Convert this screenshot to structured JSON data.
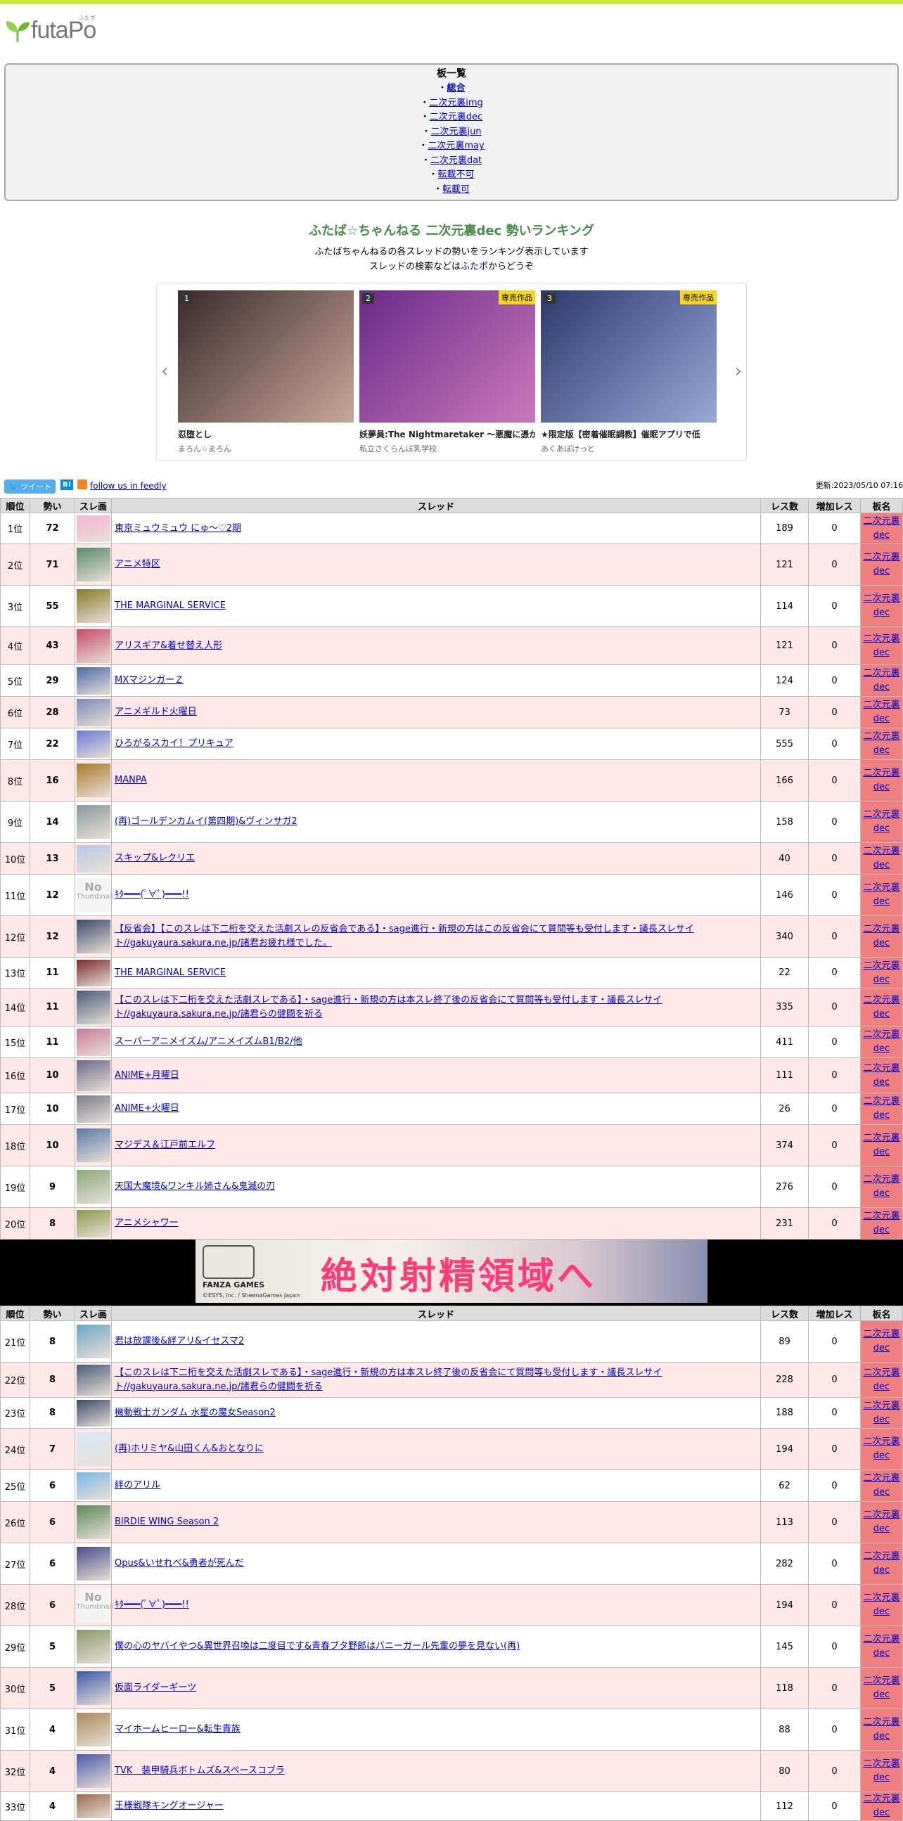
{
  "header": {
    "logo_text": "futaPo",
    "logo_ruby": "ふたポ"
  },
  "board_list": {
    "title": "板一覧",
    "items": [
      {
        "prefix": "・",
        "label": "総合",
        "strong": true
      },
      {
        "prefix": "・",
        "label": "二次元裏img",
        "strong": false
      },
      {
        "prefix": "・",
        "label": "二次元裏dec",
        "strong": false
      },
      {
        "prefix": "・",
        "label": "二次元裏jun",
        "strong": false
      },
      {
        "prefix": "・",
        "label": "二次元裏may",
        "strong": false
      },
      {
        "prefix": "・",
        "label": "二次元裏dat",
        "strong": false
      },
      {
        "prefix": "・",
        "label": "転載不可",
        "strong": false
      },
      {
        "prefix": "・",
        "label": "転載可",
        "strong": false
      }
    ]
  },
  "ranking": {
    "title": "ふたば☆ちゃんねる 二次元裏dec 勢いランキング",
    "desc1": "ふたばちゃんねるの各スレッドの勢いをランキング表示しています",
    "desc2_pre": "スレッドの検索などは",
    "desc2_link": "ふたポ",
    "desc2_post": "からどうぞ"
  },
  "carousel": {
    "prev": "‹",
    "next": "›",
    "cards": [
      {
        "num": "1",
        "excl": "",
        "title": "忍堕とし",
        "circle": "まろん☆まろん",
        "color1": "#3a2a2a",
        "color2": "#c9a89a"
      },
      {
        "num": "2",
        "excl": "専売作品",
        "title": "妖夢員:The Nightmaretaker ～悪魔に憑か",
        "circle": "私立さくらんぼ乳学校",
        "color1": "#6a2a8a",
        "color2": "#c97ab8"
      },
      {
        "num": "3",
        "excl": "専売作品",
        "title": "★限定版【密着催眠調教】催眠アプリで低",
        "circle": "あくあぽけっと",
        "color1": "#2a3a6a",
        "color2": "#9aa8d8"
      }
    ]
  },
  "social": {
    "tweet": "ツイート",
    "hatena": "B!",
    "feedly": "follow us in feedly",
    "updated": "更新:2023/05/10 07:16"
  },
  "table": {
    "headers": [
      "順位",
      "勢い",
      "スレ画",
      "スレッド",
      "レス数",
      "増加レス",
      "板名"
    ],
    "board_line1": "二次元裏",
    "board_line2": "dec",
    "rows1": [
      {
        "rank": "1位",
        "mom": "72",
        "title": "東京ミュウミュウ にゅ～♡2期",
        "res": "189",
        "inc": "0",
        "h": 44,
        "c": "#f7b4d4"
      },
      {
        "rank": "2位",
        "mom": "71",
        "title": "アニメ特区",
        "res": "121",
        "inc": "0",
        "h": 59,
        "c": "#5a8a6a"
      },
      {
        "rank": "3位",
        "mom": "55",
        "title": "THE MARGINAL SERVICE",
        "res": "114",
        "inc": "0",
        "h": 59,
        "c": "#8a7a2a"
      },
      {
        "rank": "4位",
        "mom": "43",
        "title": "アリスギア&着せ替え人形",
        "res": "121",
        "inc": "0",
        "h": 54,
        "c": "#c94a6a"
      },
      {
        "rank": "5位",
        "mom": "29",
        "title": "MXマジンガーＺ",
        "res": "124",
        "inc": "0",
        "h": 45,
        "c": "#4a6aaa"
      },
      {
        "rank": "6位",
        "mom": "28",
        "title": "アニメギルド火曜日",
        "res": "73",
        "inc": "0",
        "h": 45,
        "c": "#7a8ab8"
      },
      {
        "rank": "7位",
        "mom": "22",
        "title": "ひろがるスカイ！プリキュア",
        "res": "555",
        "inc": "0",
        "h": 45,
        "c": "#6a7ad8"
      },
      {
        "rank": "8位",
        "mom": "16",
        "title": "MANPA",
        "res": "166",
        "inc": "0",
        "h": 59,
        "c": "#aa7a2a"
      },
      {
        "rank": "9位",
        "mom": "14",
        "title": "(再)ゴールデンカムイ(第四期)&ヴィンサガ2",
        "res": "158",
        "inc": "0",
        "h": 59,
        "c": "#8a9a9a"
      },
      {
        "rank": "10位",
        "mom": "13",
        "title": "スキップ&レクリエ",
        "res": "40",
        "inc": "0",
        "h": 45,
        "c": "#b8c8e8"
      },
      {
        "rank": "11位",
        "mom": "12",
        "title": "ｷﾀ━━━(ﾟ∀ﾟ)━━━!!",
        "res": "146",
        "inc": "0",
        "h": 59,
        "c": "none"
      },
      {
        "rank": "12位",
        "mom": "12",
        "title": "【反省会】【このスレは下二桁を交えた活劇スレの反省会である】・sage進行・新規の方はこの反省会にて質問等も受付します・議長スレサイト//gakuyaura.sakura.ne.jp/諸君お疲れ様でした。",
        "res": "340",
        "inc": "0",
        "h": 59,
        "c": "#3a4a6a"
      },
      {
        "rank": "13位",
        "mom": "11",
        "title": "THE MARGINAL SERVICE",
        "res": "22",
        "inc": "0",
        "h": 44,
        "c": "#7a2a2a"
      },
      {
        "rank": "14位",
        "mom": "11",
        "title": "【このスレは下二桁を交えた活劇スレである】・sage進行・新規の方は本スレ終了後の反省会にて質問等も受付します・議長スレサイト//gakuyaura.sakura.ne.jp/諸君らの健闘を祈る",
        "res": "335",
        "inc": "0",
        "h": 54,
        "c": "#4a5a7a"
      },
      {
        "rank": "15位",
        "mom": "11",
        "title": "スーパーアニメイズム/アニメイズムB1/B2/他",
        "res": "411",
        "inc": "0",
        "h": 45,
        "c": "#c87a9a"
      },
      {
        "rank": "16位",
        "mom": "10",
        "title": "ANIME+月曜日",
        "res": "111",
        "inc": "0",
        "h": 50,
        "c": "#6a6a8a"
      },
      {
        "rank": "17位",
        "mom": "10",
        "title": "ANIME+火曜日",
        "res": "26",
        "inc": "0",
        "h": 45,
        "c": "#7a7a8a"
      },
      {
        "rank": "18位",
        "mom": "10",
        "title": "マジデス＆江戸前エルフ",
        "res": "374",
        "inc": "0",
        "h": 59,
        "c": "#5a7aaa"
      },
      {
        "rank": "19位",
        "mom": "9",
        "title": "天国大魔境&ワンキル姉さん&鬼滅の刃",
        "res": "276",
        "inc": "0",
        "h": 59,
        "c": "#8aaa7a"
      },
      {
        "rank": "20位",
        "mom": "8",
        "title": "アニメシャワー",
        "res": "231",
        "inc": "0",
        "h": 45,
        "c": "#8a9a4a"
      }
    ],
    "rows2": [
      {
        "rank": "21位",
        "mom": "8",
        "title": "君は放課後&絆アリ&イセスマ2",
        "res": "89",
        "inc": "0",
        "h": 59,
        "c": "#6aa8c8"
      },
      {
        "rank": "22位",
        "mom": "8",
        "title": "【このスレは下二桁を交えた活劇スレである】・sage進行・新規の方は本スレ終了後の反省会にて質問等も受付します・議長スレサイト//gakuyaura.sakura.ne.jp/諸君らの健闘を祈る",
        "res": "228",
        "inc": "0",
        "h": 50,
        "c": "#4a5a7a"
      },
      {
        "rank": "23位",
        "mom": "8",
        "title": "機動戦士ガンダム 水星の魔女Season2",
        "res": "188",
        "inc": "0",
        "h": 44,
        "c": "#3a4a6a"
      },
      {
        "rank": "24位",
        "mom": "7",
        "title": "(再)ホリミヤ&山田くん&おとなりに",
        "res": "194",
        "inc": "0",
        "h": 59,
        "c": "#d8e8f8"
      },
      {
        "rank": "25位",
        "mom": "6",
        "title": "絆のアリル",
        "res": "62",
        "inc": "0",
        "h": 45,
        "c": "#7ab8e8"
      },
      {
        "rank": "26位",
        "mom": "6",
        "title": "BIRDIE WING Season 2",
        "res": "113",
        "inc": "0",
        "h": 59,
        "c": "#5a8a5a"
      },
      {
        "rank": "27位",
        "mom": "6",
        "title": "Opus&いせれべ&勇者が死んだ",
        "res": "282",
        "inc": "0",
        "h": 59,
        "c": "#4a4a8a"
      },
      {
        "rank": "28位",
        "mom": "6",
        "title": "ｷﾀ━━━(ﾟ∀ﾟ)━━━!!",
        "res": "194",
        "inc": "0",
        "h": 59,
        "c": "none"
      },
      {
        "rank": "29位",
        "mom": "5",
        "title": "僕の心のヤバイやつ&異世界召喚は二度目です&青春ブタ野郎はバニーガール先輩の夢を見ない(再)",
        "res": "145",
        "inc": "0",
        "h": 59,
        "c": "#8a9a6a"
      },
      {
        "rank": "30位",
        "mom": "5",
        "title": "仮面ライダーギーツ",
        "res": "118",
        "inc": "0",
        "h": 59,
        "c": "#3a5aaa"
      },
      {
        "rank": "31位",
        "mom": "4",
        "title": "マイホームヒーロー&転生貴族",
        "res": "88",
        "inc": "0",
        "h": 59,
        "c": "#aa8a5a"
      },
      {
        "rank": "32位",
        "mom": "4",
        "title": "TVK　装甲騎兵ボトムズ&スペースコブラ",
        "res": "80",
        "inc": "0",
        "h": 59,
        "c": "#4a5aaa"
      },
      {
        "rank": "33位",
        "mom": "4",
        "title": "王様戦隊キングオージャー",
        "res": "112",
        "inc": "0",
        "h": 40,
        "c": "#9a6a4a"
      }
    ],
    "no_thumb_line1": "No",
    "no_thumb_line2": "Thumbnail"
  },
  "ad": {
    "big_text": "絶対射精領域へ",
    "brand": "FANZA GAMES",
    "copyright": "©ESYS, Inc. / SheenaGames Japan"
  }
}
